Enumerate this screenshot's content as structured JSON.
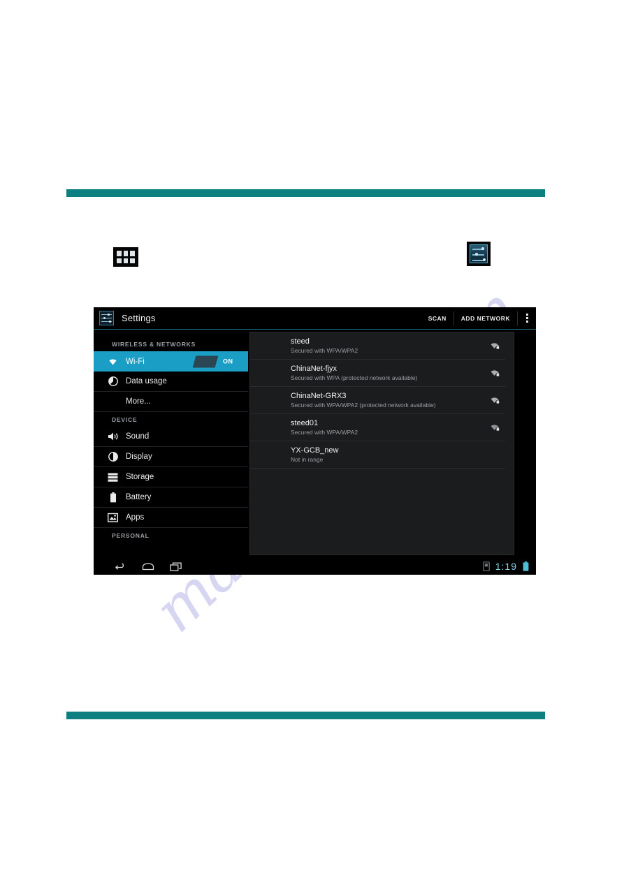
{
  "page": {
    "rule_color": "#0d7f80",
    "watermark_text": "manualslib.com",
    "apps_grid_icon": "apps-grid-icon",
    "settings_app_icon": "settings-app-icon"
  },
  "tablet": {
    "actionbar": {
      "app_icon": "settings-sliders-icon",
      "title": "Settings",
      "scan_label": "SCAN",
      "add_network_label": "ADD NETWORK",
      "overflow_icon": "overflow-menu-icon"
    },
    "sidebar": {
      "sections": [
        {
          "header": "WIRELESS & NETWORKS",
          "items": [
            {
              "label": "Wi-Fi",
              "icon": "wifi-icon",
              "selected": true,
              "toggle": "ON"
            },
            {
              "label": "Data usage",
              "icon": "data-usage-icon",
              "selected": false
            },
            {
              "label": "More...",
              "icon": "",
              "selected": false
            }
          ]
        },
        {
          "header": "DEVICE",
          "items": [
            {
              "label": "Sound",
              "icon": "sound-icon",
              "selected": false
            },
            {
              "label": "Display",
              "icon": "display-icon",
              "selected": false
            },
            {
              "label": "Storage",
              "icon": "storage-icon",
              "selected": false
            },
            {
              "label": "Battery",
              "icon": "battery-icon",
              "selected": false
            },
            {
              "label": "Apps",
              "icon": "apps-icon",
              "selected": false
            }
          ]
        },
        {
          "header": "PERSONAL",
          "items": []
        }
      ]
    },
    "wifi_networks": [
      {
        "ssid": "steed",
        "status": "Secured with WPA/WPA2",
        "signal_icon": "wifi-signal-secure-icon"
      },
      {
        "ssid": "ChinaNet-fjyx",
        "status": "Secured with WPA (protected network available)",
        "signal_icon": "wifi-signal-secure-icon"
      },
      {
        "ssid": "ChinaNet-GRX3",
        "status": "Secured with WPA/WPA2 (protected network available)",
        "signal_icon": "wifi-signal-secure-icon"
      },
      {
        "ssid": "steed01",
        "status": "Secured with WPA/WPA2",
        "signal_icon": "wifi-signal-secure-icon"
      },
      {
        "ssid": "YX-GCB_new",
        "status": "Not in range",
        "signal_icon": ""
      }
    ],
    "navbar": {
      "back_icon": "back-arrow-icon",
      "home_icon": "home-icon",
      "recents_icon": "recent-apps-icon",
      "usb_icon": "usb-storage-icon",
      "clock": "1:19",
      "battery_icon": "battery-status-icon",
      "accent_color": "#7fd4e8"
    }
  }
}
